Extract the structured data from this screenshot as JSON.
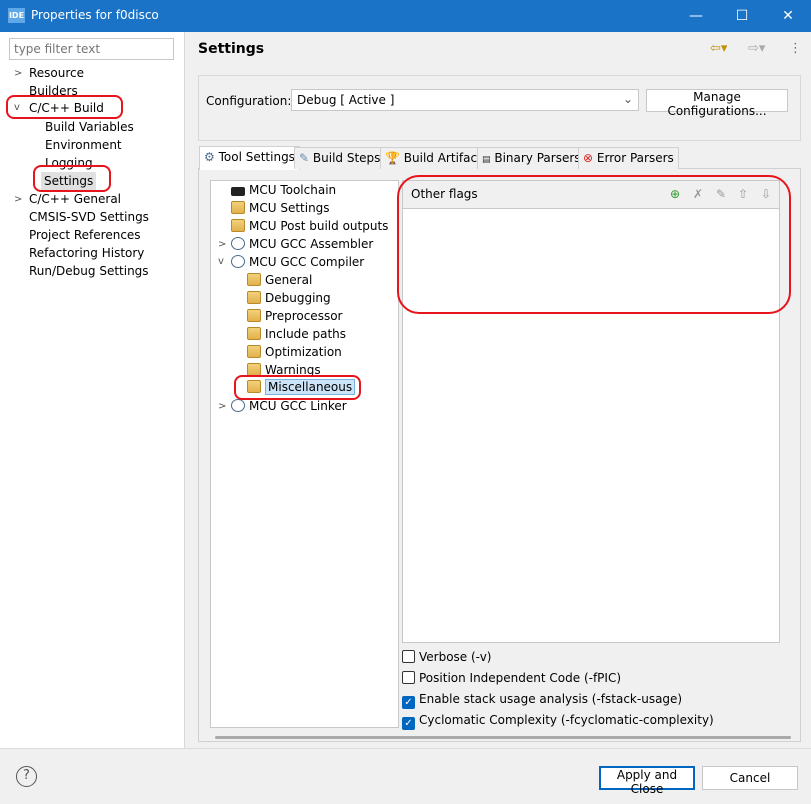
{
  "window": {
    "logo": "IDE",
    "title": "Properties for f0disco",
    "minimize": "—",
    "maximize": "☐",
    "close": "✕"
  },
  "left": {
    "filter_placeholder": "type filter text",
    "items": [
      {
        "label": "Resource",
        "expanded": false
      },
      {
        "label": "Builders"
      },
      {
        "label": "C/C++ Build",
        "expanded": true
      },
      {
        "label": "Build Variables"
      },
      {
        "label": "Environment"
      },
      {
        "label": "Logging"
      },
      {
        "label": "Settings",
        "selected": true
      },
      {
        "label": "C/C++ General",
        "expanded": false
      },
      {
        "label": "CMSIS-SVD Settings"
      },
      {
        "label": "Project References"
      },
      {
        "label": "Refactoring History"
      },
      {
        "label": "Run/Debug Settings"
      }
    ]
  },
  "main": {
    "heading": "Settings",
    "config_label": "Configuration:",
    "config_value": "Debug  [ Active ]",
    "manage_button": "Manage Configurations...",
    "tabs": [
      {
        "label": "Tool Settings",
        "active": true,
        "icon": "tool-settings-icon"
      },
      {
        "label": "Build Steps",
        "icon": "build-steps-icon"
      },
      {
        "label": "Build Artifact",
        "icon": "trophy-icon"
      },
      {
        "label": "Binary Parsers",
        "icon": "binary-icon"
      },
      {
        "label": "Error Parsers",
        "icon": "error-icon"
      }
    ],
    "tree": [
      {
        "label": "MCU Toolchain"
      },
      {
        "label": "MCU Settings"
      },
      {
        "label": "MCU Post build outputs"
      },
      {
        "label": "MCU GCC Assembler",
        "expanded": false
      },
      {
        "label": "MCU GCC Compiler",
        "expanded": true
      },
      {
        "label": "General"
      },
      {
        "label": "Debugging"
      },
      {
        "label": "Preprocessor"
      },
      {
        "label": "Include paths"
      },
      {
        "label": "Optimization"
      },
      {
        "label": "Warnings"
      },
      {
        "label": "Miscellaneous",
        "selected": true
      },
      {
        "label": "MCU GCC Linker",
        "expanded": false
      }
    ],
    "flags_title": "Other flags",
    "checkboxes": [
      {
        "label": "Verbose (-v)",
        "checked": false
      },
      {
        "label": "Position Independent Code (-fPIC)",
        "checked": false
      },
      {
        "label": "Enable stack usage analysis (-fstack-usage)",
        "checked": true
      },
      {
        "label": "Cyclomatic Complexity (-fcyclomatic-complexity)",
        "checked": true
      }
    ]
  },
  "footer": {
    "help": "?",
    "apply_close": "Apply and Close",
    "cancel": "Cancel"
  },
  "colors": {
    "titlebar": "#1a73c7",
    "annotation": "#e8141c",
    "accent": "#0067c0"
  }
}
